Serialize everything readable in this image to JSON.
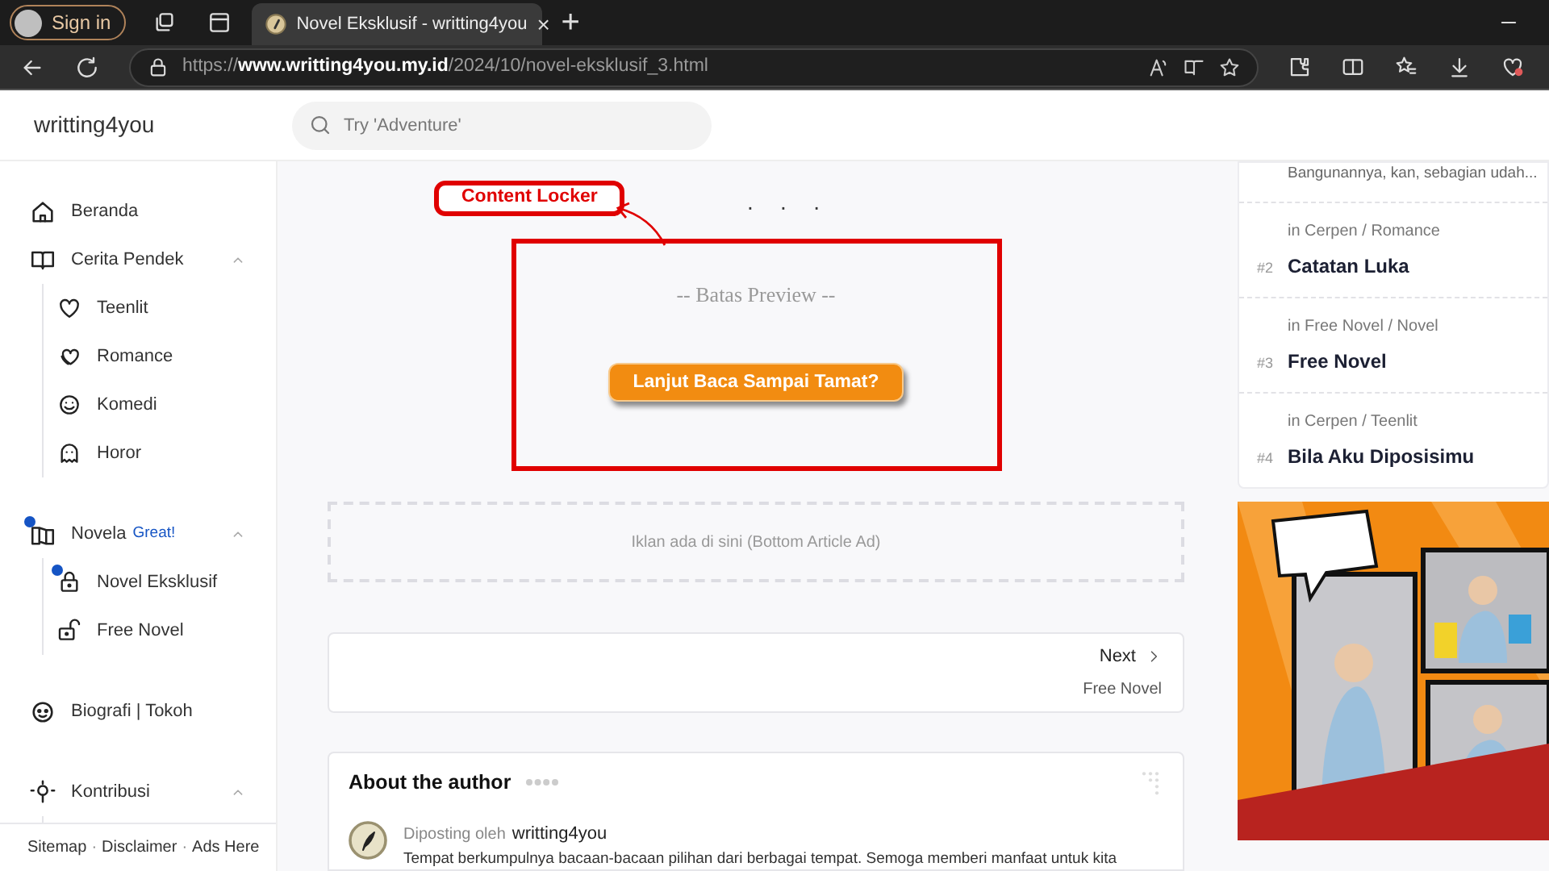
{
  "browser": {
    "profile_button": "Sign in",
    "tabs": [
      {
        "title": "Novel Eksklusif - writting4you",
        "selected": true,
        "close": "×"
      }
    ],
    "new_tab": "+",
    "url": "https://**www.writting4you.my.id**/2024/10/novel-eksklusif_3.html"
  },
  "header": {
    "logo": "writting4you",
    "search": {
      "placeholder": "Try 'Adventure'"
    }
  },
  "sidebar": {
    "items": [
      {
        "label": "Beranda",
        "active": false
      },
      {
        "label": "Cerita Pendek",
        "active": false,
        "expanded": true,
        "children": [
          {
            "label": "Teenlit",
            "active": false
          },
          {
            "label": "Romance",
            "active": false
          },
          {
            "label": "Komedi",
            "active": false
          },
          {
            "label": "Horor",
            "active": false
          }
        ]
      },
      {
        "label": "Novela",
        "badge": "Great!",
        "active": true,
        "expanded": true,
        "children": [
          {
            "label": "Novel Eksklusif",
            "active": true
          },
          {
            "label": "Free Novel",
            "active": false
          }
        ]
      },
      {
        "label": "Biografi | Tokoh",
        "active": false
      },
      {
        "label": "Kontribusi",
        "active": false,
        "expanded": true
      }
    ],
    "footer_links": [
      "Sitemap",
      "Disclaimer",
      "Ads Here"
    ],
    "footer_separator": "·"
  },
  "article": {
    "separator": "· · ·",
    "locker": {
      "title": "-- Batas Preview --",
      "button": "Lanjut Baca Sampai Tamat?"
    },
    "annotation": "Content Locker",
    "ad_placeholder": "Iklan ada di sini (Bottom Article Ad)",
    "next": {
      "label": "Next",
      "title": "Free Novel"
    },
    "author": {
      "heading": "About the author",
      "posted_by": "Diposting oleh",
      "name": "writting4you",
      "bio": "Tempat berkumpulnya bacaan-bacaan pilihan dari berbagai tempat. Semoga memberi manfaat untuk kita"
    }
  },
  "popular": {
    "snippet": "Bangunannya, kan, sebagian udah...",
    "items": [
      {
        "category": "in Cerpen / Romance",
        "rank": "#2",
        "title": "Catatan Luka"
      },
      {
        "category": "in Free Novel / Novel",
        "rank": "#3",
        "title": "Free Novel"
      },
      {
        "category": "in Cerpen / Teenlit",
        "rank": "#4",
        "title": "Bila Aku Diposisimu"
      }
    ]
  }
}
